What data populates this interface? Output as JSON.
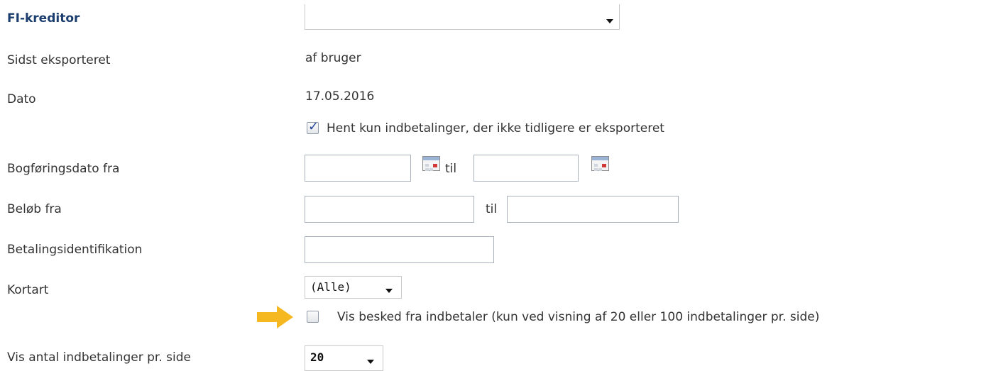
{
  "form": {
    "fi_kreditor_label": "FI-kreditor",
    "fi_kreditor_value": "",
    "sidst_eksporteret_label": "Sidst eksporteret",
    "sidst_eksporteret_value": "af bruger",
    "dato_label": "Dato",
    "dato_value": "17.05.2016",
    "hent_kun_checkbox_label": "Hent kun indbetalinger, der ikke tidligere er eksporteret",
    "hent_kun_checked": true,
    "bogforingsdato_label": "Bogføringsdato fra",
    "bogforingsdato_from": "",
    "bogforingsdato_til_label": "til",
    "bogforingsdato_to": "",
    "belob_label": "Beløb fra",
    "belob_from": "",
    "belob_til_label": "til",
    "belob_to": "",
    "betalingsid_label": "Betalingsidentifikation",
    "betalingsid_value": "",
    "kortart_label": "Kortart",
    "kortart_value": "(Alle)",
    "vis_besked_label": "Vis besked fra indbetaler (kun ved visning af 20 eller 100 indbetalinger pr. side)",
    "vis_besked_checked": false,
    "vis_antal_label": "Vis antal indbetalinger pr. side",
    "vis_antal_value": "20"
  },
  "colors": {
    "title": "#1b3e6f",
    "text": "#333333",
    "highlight_arrow": "#f5b820"
  },
  "icons": {
    "calendar": "calendar-icon",
    "dropdown": "chevron-down-icon",
    "highlight": "arrow-right-icon"
  }
}
